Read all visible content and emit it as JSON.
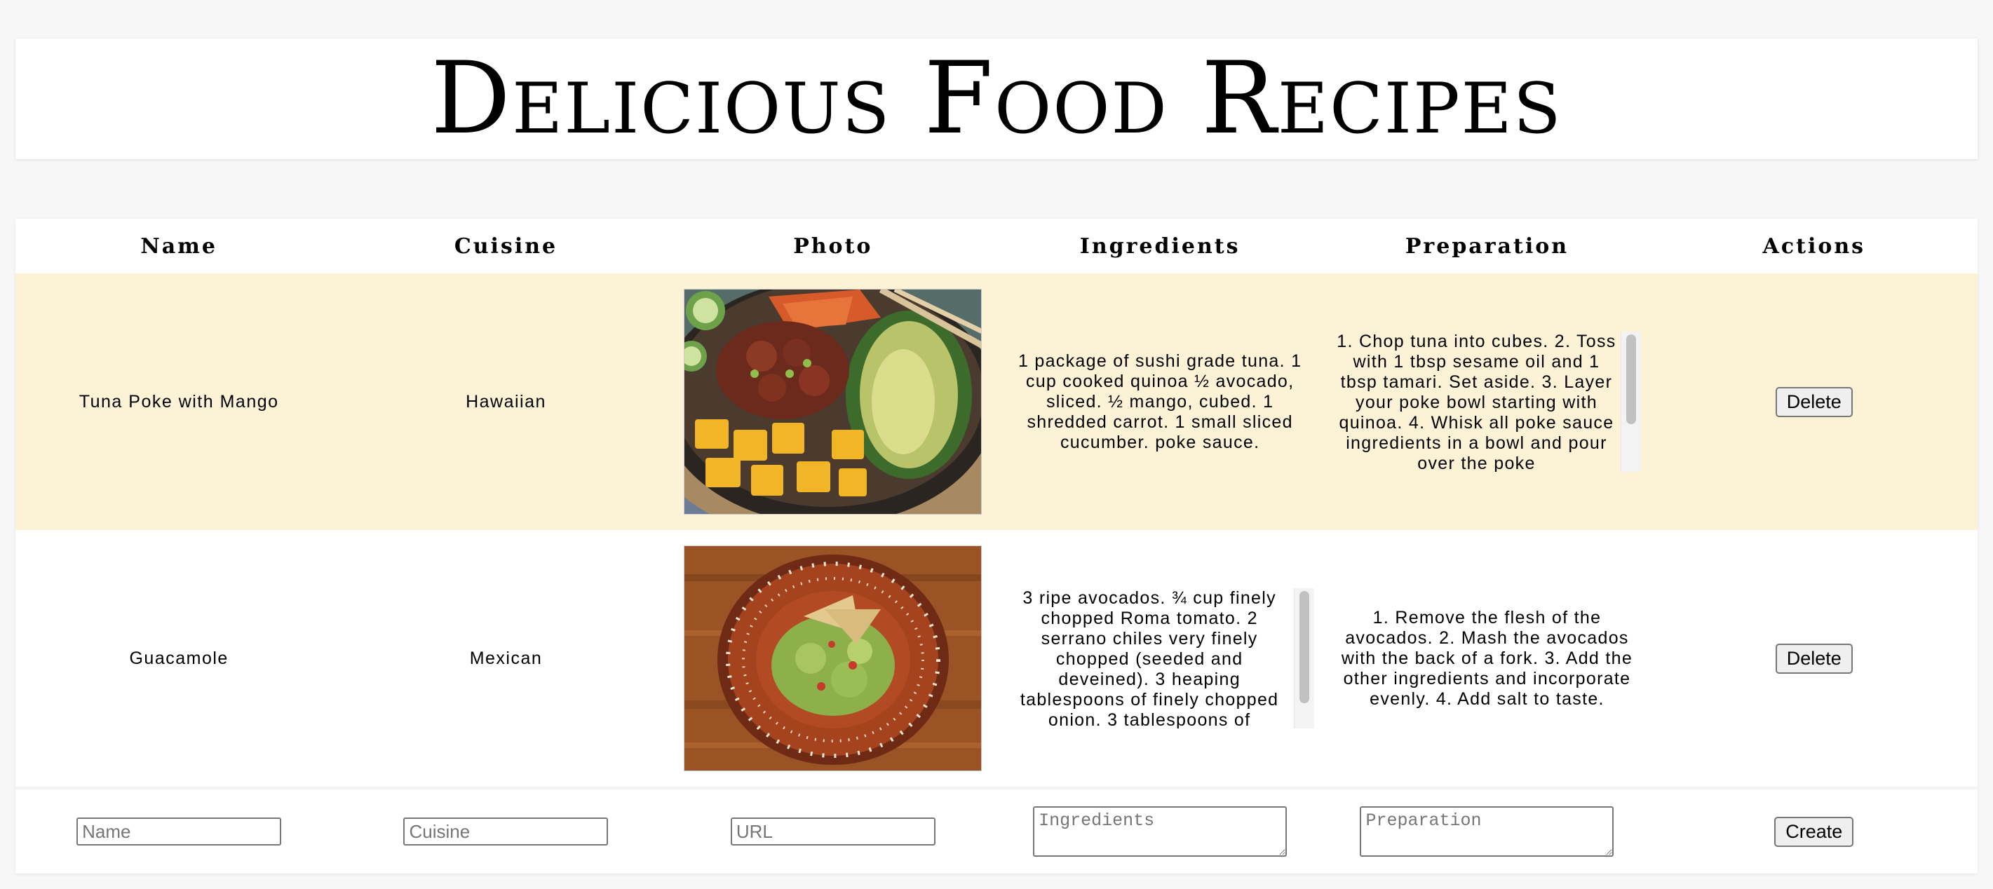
{
  "page": {
    "title": "Delicious Food Recipes"
  },
  "table": {
    "headers": [
      "Name",
      "Cuisine",
      "Photo",
      "Ingredients",
      "Preparation",
      "Actions"
    ],
    "recipes": [
      {
        "name": "Tuna Poke with Mango",
        "cuisine": "Hawaiian",
        "photo_alt": "Tuna poke bowl with mango, avocado and quinoa",
        "ingredients": "1 package of sushi grade tuna. 1 cup cooked quinoa ½ avocado, sliced. ½ mango, cubed. 1 shredded carrot. 1 small sliced cucumber. poke sauce.",
        "preparation": "1. Chop tuna into cubes. 2. Toss with 1 tbsp sesame oil and 1 tbsp tamari. Set aside. 3. Layer your poke bowl starting with quinoa. 4. Whisk all poke sauce ingredients in a bowl and pour over the poke",
        "delete_label": "Delete"
      },
      {
        "name": "Guacamole",
        "cuisine": "Mexican",
        "photo_alt": "Guacamole with tortilla chips on a decorated clay plate",
        "ingredients": "3 ripe avocados. ¾ cup finely chopped Roma tomato. 2 serrano chiles very finely chopped (seeded and deveined). 3 heaping tablespoons of finely chopped onion. 3 tablespoons of",
        "preparation": "1. Remove the flesh of the avocados. 2. Mash the avocados with the back of a fork. 3. Add the other ingredients and incorporate evenly. 4. Add salt to taste.",
        "delete_label": "Delete"
      }
    ]
  },
  "form": {
    "name_placeholder": "Name",
    "cuisine_placeholder": "Cuisine",
    "url_placeholder": "URL",
    "ingredients_placeholder": "Ingredients",
    "preparation_placeholder": "Preparation",
    "create_label": "Create"
  },
  "colors": {
    "highlight_row": "#fcf2d6",
    "background": "#f7f7f7"
  }
}
